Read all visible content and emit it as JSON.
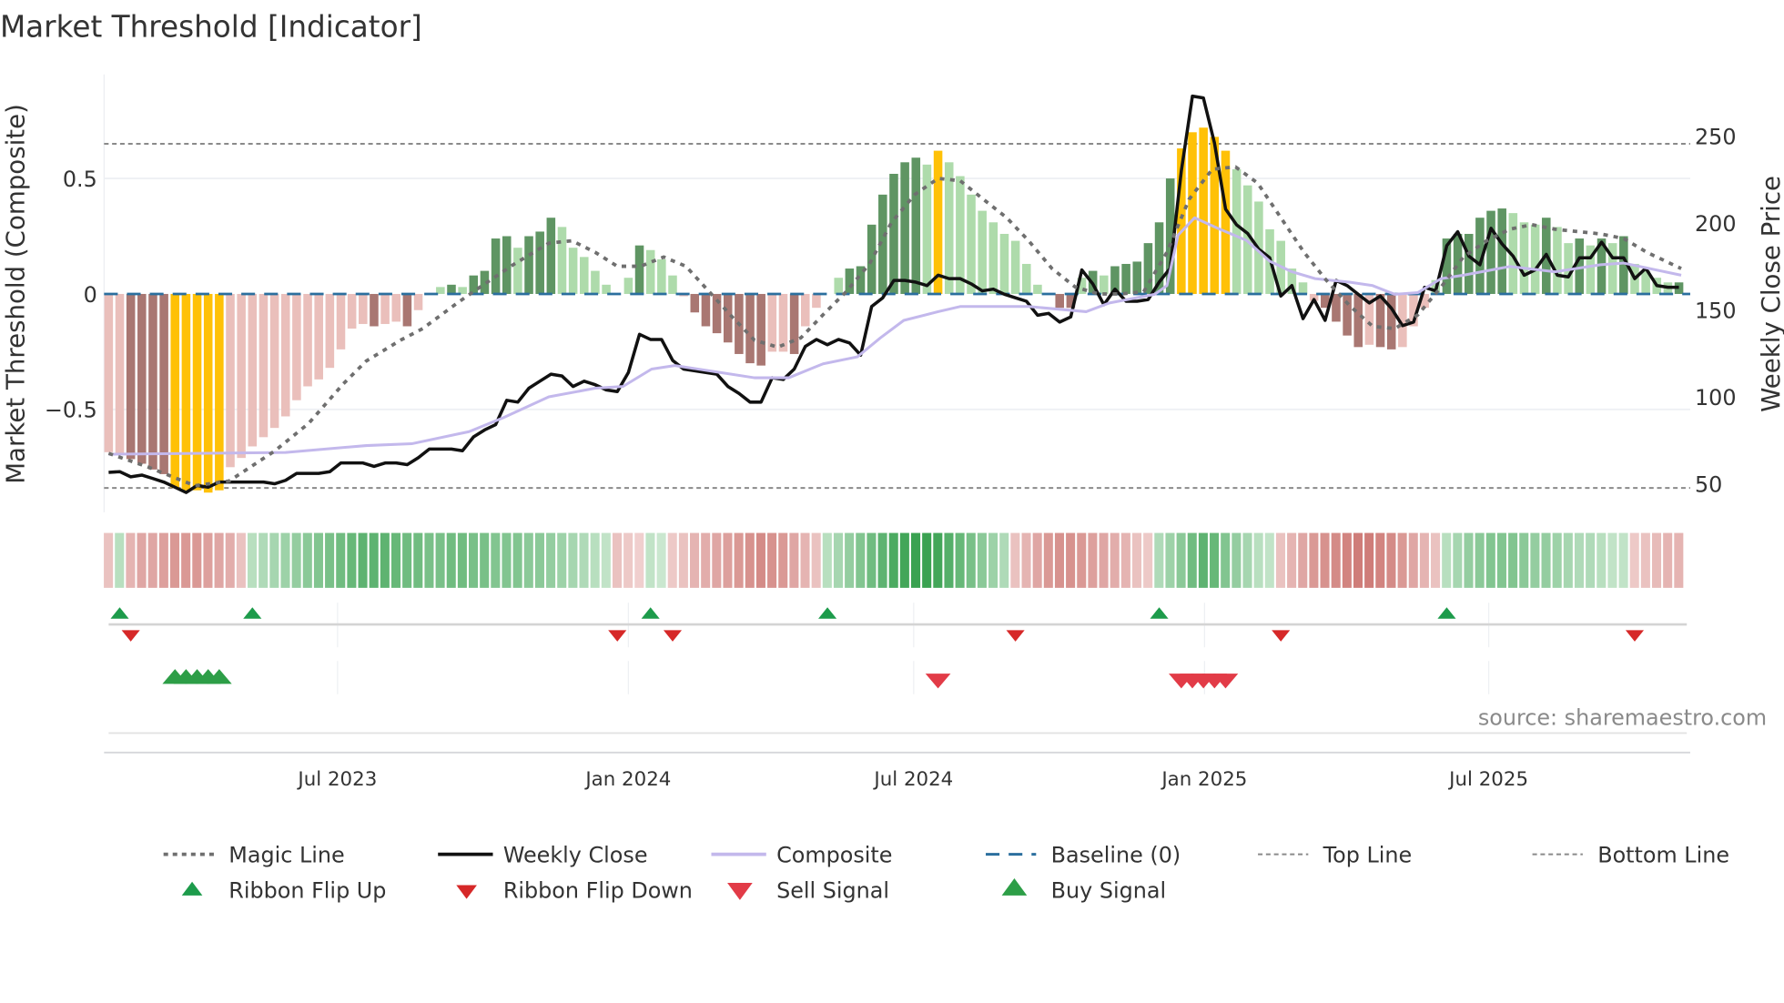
{
  "title": "Market Threshold [Indicator]",
  "source": "source: sharemaestro.com",
  "colors": {
    "bar_light_green": "#aedbab",
    "bar_dark_green": "#5f9563",
    "bar_yellow": "#ffc107",
    "bar_light_red": "#eabfbb",
    "bar_dark_red": "#a97772",
    "weekly_close": "#111111",
    "composite": "#c3b8ec",
    "magic_line": "#6f6f6f",
    "baseline": "#2b6f9e",
    "flip_up": "#1d9b4b",
    "flip_down": "#d62828",
    "buy": "#2d9e47",
    "sell": "#e23b47"
  },
  "chart_data": {
    "type": "bar",
    "title": "Market Threshold [Indicator]",
    "ylabel": "Market Threshold (Composite)",
    "ylabel_right": "Weekly Close Price",
    "ylim": [
      -0.9,
      0.9
    ],
    "ylim_right": [
      46,
      290
    ],
    "yticks": [
      {
        "v": 0.5,
        "label": "0.5"
      },
      {
        "v": 0,
        "label": "0"
      },
      {
        "v": -0.5,
        "label": "−0.5"
      }
    ],
    "yticks_right": [
      {
        "v": 250,
        "label": "250"
      },
      {
        "v": 200,
        "label": "200"
      },
      {
        "v": 150,
        "label": "150"
      },
      {
        "v": 100,
        "label": "100"
      },
      {
        "v": 50,
        "label": "50"
      }
    ],
    "xticks": [
      {
        "week": 20.7,
        "label": "Jul 2023"
      },
      {
        "week": 47.0,
        "label": "Jan 2024"
      },
      {
        "week": 72.8,
        "label": "Jul 2024"
      },
      {
        "week": 99.1,
        "label": "Jan 2025"
      },
      {
        "week": 124.8,
        "label": "Jul 2025"
      }
    ],
    "top_line": 0.65,
    "bottom_line": -0.84,
    "baseline": 0,
    "composite_bars": {
      "values": [
        -0.685,
        -0.69,
        -0.715,
        -0.735,
        -0.76,
        -0.78,
        -0.84,
        -0.85,
        -0.85,
        -0.86,
        -0.85,
        -0.75,
        -0.71,
        -0.66,
        -0.62,
        -0.58,
        -0.53,
        -0.46,
        -0.4,
        -0.37,
        -0.32,
        -0.24,
        -0.15,
        -0.13,
        -0.14,
        -0.13,
        -0.12,
        -0.14,
        -0.07,
        0,
        0.03,
        0.04,
        0.03,
        0.08,
        0.1,
        0.24,
        0.25,
        0.2,
        0.25,
        0.27,
        0.33,
        0.29,
        0.2,
        0.16,
        0.1,
        0.04,
        0,
        0.07,
        0.21,
        0.19,
        0.15,
        0.08,
        -0.01,
        -0.08,
        -0.14,
        -0.17,
        -0.21,
        -0.26,
        -0.3,
        -0.31,
        -0.25,
        -0.25,
        -0.26,
        -0.14,
        -0.06,
        0,
        0.07,
        0.11,
        0.12,
        0.3,
        0.43,
        0.52,
        0.57,
        0.59,
        0.56,
        0.62,
        0.57,
        0.51,
        0.43,
        0.36,
        0.31,
        0.26,
        0.23,
        0.13,
        0.04,
        0,
        -0.06,
        -0.06,
        0.07,
        0.1,
        0.08,
        0.12,
        0.13,
        0.14,
        0.22,
        0.31,
        0.5,
        0.63,
        0.7,
        0.72,
        0.68,
        0.62,
        0.54,
        0.47,
        0.4,
        0.28,
        0.23,
        0.11,
        0.05,
        -0.03,
        -0.06,
        -0.12,
        -0.18,
        -0.23,
        -0.22,
        -0.23,
        -0.24,
        -0.23,
        -0.14,
        -0.06,
        0.06,
        0.24,
        0.26,
        0.26,
        0.33,
        0.36,
        0.37,
        0.35,
        0.31,
        0.3,
        0.33,
        0.29,
        0.22,
        0.24,
        0.21,
        0.24,
        0.22,
        0.25,
        0.13,
        0.1,
        0.07,
        0.05,
        0.05
      ],
      "states": [
        "l",
        "l",
        "d",
        "d",
        "d",
        "d",
        "Y",
        "Y",
        "Y",
        "Y",
        "Y",
        "l",
        "l",
        "l",
        "l",
        "l",
        "l",
        "l",
        "l",
        "l",
        "l",
        "l",
        "l",
        "l",
        "d",
        "l",
        "l",
        "d",
        "l",
        "z",
        "L",
        "D",
        "L",
        "D",
        "D",
        "D",
        "D",
        "L",
        "D",
        "D",
        "D",
        "L",
        "L",
        "L",
        "L",
        "L",
        "z",
        "L",
        "D",
        "L",
        "L",
        "L",
        "l",
        "d",
        "d",
        "d",
        "d",
        "d",
        "d",
        "d",
        "l",
        "l",
        "d",
        "l",
        "l",
        "z",
        "L",
        "D",
        "D",
        "D",
        "D",
        "D",
        "D",
        "D",
        "L",
        "Y",
        "L",
        "L",
        "L",
        "L",
        "L",
        "L",
        "L",
        "L",
        "L",
        "z",
        "d",
        "d",
        "L",
        "D",
        "L",
        "D",
        "D",
        "D",
        "D",
        "D",
        "D",
        "Y",
        "Y",
        "Y",
        "Y",
        "Y",
        "L",
        "L",
        "L",
        "L",
        "L",
        "L",
        "L",
        "l",
        "d",
        "d",
        "d",
        "d",
        "l",
        "d",
        "d",
        "l",
        "l",
        "l",
        "L",
        "D",
        "D",
        "D",
        "D",
        "D",
        "D",
        "L",
        "L",
        "L",
        "D",
        "L",
        "L",
        "D",
        "L",
        "D",
        "L",
        "D",
        "L",
        "L",
        "L",
        "L",
        "D"
      ]
    },
    "series": [
      {
        "name": "Weekly Close",
        "axis": "right",
        "values": [
          56.6,
          57,
          54,
          55,
          53,
          51,
          48,
          45,
          49,
          48,
          51,
          51,
          51,
          51,
          51,
          50,
          52,
          56,
          56,
          56,
          57,
          62,
          62,
          62,
          60,
          62,
          62,
          61,
          65,
          70,
          70,
          70,
          69,
          77,
          81,
          84,
          98,
          97,
          105,
          109,
          113,
          112,
          106,
          109,
          107,
          104,
          103,
          114,
          136,
          133,
          133,
          121,
          116,
          115,
          114,
          113,
          106,
          102,
          97,
          97,
          111,
          110,
          116,
          129,
          133,
          130,
          133,
          131,
          124,
          152,
          157,
          167,
          167,
          166,
          164,
          170,
          168,
          168,
          165,
          161,
          162,
          159,
          157,
          155,
          147,
          148,
          143,
          146,
          173,
          165,
          153,
          162,
          155,
          155,
          156,
          166,
          174,
          230,
          273,
          272,
          246,
          208,
          199,
          194,
          185,
          180,
          158,
          164,
          145,
          156,
          144,
          167,
          164,
          159,
          154,
          158,
          151,
          141,
          143,
          163,
          161,
          187,
          195,
          181,
          176,
          197,
          188,
          181,
          170,
          173,
          182,
          170,
          169,
          180,
          180,
          189,
          180,
          180,
          168,
          174,
          164,
          163,
          163
        ]
      },
      {
        "name": "Composite",
        "axis": "right",
        "points": [
          [
            0,
            67
          ],
          [
            16,
            68
          ],
          [
            23.3,
            72
          ],
          [
            27.4,
            73
          ],
          [
            32.6,
            80
          ],
          [
            35.7,
            88
          ],
          [
            39.8,
            100
          ],
          [
            44,
            105
          ],
          [
            46.5,
            106
          ],
          [
            49.1,
            116
          ],
          [
            51.2,
            118
          ],
          [
            55.3,
            114
          ],
          [
            58.4,
            111
          ],
          [
            61.5,
            111
          ],
          [
            64.6,
            119
          ],
          [
            67.7,
            123
          ],
          [
            69.8,
            134
          ],
          [
            71.9,
            144
          ],
          [
            75,
            149
          ],
          [
            77,
            152
          ],
          [
            83.2,
            152
          ],
          [
            88.4,
            149
          ],
          [
            90.5,
            154
          ],
          [
            94.6,
            159
          ],
          [
            95.7,
            164
          ],
          [
            96.7,
            193
          ],
          [
            98.2,
            203
          ],
          [
            100.3,
            197
          ],
          [
            102.9,
            190
          ],
          [
            105,
            178
          ],
          [
            107,
            172
          ],
          [
            109.1,
            168
          ],
          [
            112.2,
            166
          ],
          [
            114.3,
            164
          ],
          [
            116.3,
            159
          ],
          [
            118.4,
            160
          ],
          [
            120.5,
            168
          ],
          [
            122.5,
            170
          ],
          [
            126.7,
            175
          ],
          [
            130.8,
            172
          ],
          [
            134.9,
            176
          ],
          [
            137,
            177
          ],
          [
            142.2,
            170
          ]
        ]
      },
      {
        "name": "Magic Line",
        "axis": "left",
        "points": [
          [
            0,
            -0.69
          ],
          [
            3.6,
            -0.75
          ],
          [
            7.8,
            -0.83
          ],
          [
            10.9,
            -0.81
          ],
          [
            15,
            -0.68
          ],
          [
            18.1,
            -0.56
          ],
          [
            21.2,
            -0.39
          ],
          [
            23.3,
            -0.29
          ],
          [
            26.4,
            -0.2
          ],
          [
            28.4,
            -0.15
          ],
          [
            31.5,
            -0.04
          ],
          [
            33.6,
            0.03
          ],
          [
            36.7,
            0.13
          ],
          [
            39.8,
            0.22
          ],
          [
            41.9,
            0.23
          ],
          [
            44,
            0.18
          ],
          [
            46,
            0.12
          ],
          [
            48.1,
            0.12
          ],
          [
            50.2,
            0.16
          ],
          [
            52.2,
            0.12
          ],
          [
            54.3,
            0.01
          ],
          [
            56.4,
            -0.1
          ],
          [
            58.4,
            -0.2
          ],
          [
            60.5,
            -0.23
          ],
          [
            62.6,
            -0.19
          ],
          [
            64.6,
            -0.09
          ],
          [
            66.7,
            0.01
          ],
          [
            68.8,
            0.13
          ],
          [
            70.8,
            0.31
          ],
          [
            72.9,
            0.43
          ],
          [
            75,
            0.5
          ],
          [
            77,
            0.49
          ],
          [
            79.1,
            0.41
          ],
          [
            81.2,
            0.33
          ],
          [
            83.2,
            0.23
          ],
          [
            85.3,
            0.11
          ],
          [
            87.4,
            0.03
          ],
          [
            89.5,
            0
          ],
          [
            91.5,
            0
          ],
          [
            93.6,
            0.01
          ],
          [
            95.7,
            0.18
          ],
          [
            97.7,
            0.41
          ],
          [
            99.8,
            0.54
          ],
          [
            101.9,
            0.55
          ],
          [
            103.9,
            0.48
          ],
          [
            106,
            0.33
          ],
          [
            108.1,
            0.18
          ],
          [
            110.1,
            0.06
          ],
          [
            112.2,
            -0.05
          ],
          [
            114.3,
            -0.14
          ],
          [
            116.3,
            -0.15
          ],
          [
            118.4,
            -0.09
          ],
          [
            120.5,
            0.03
          ],
          [
            122.5,
            0.16
          ],
          [
            124.6,
            0.23
          ],
          [
            126.7,
            0.28
          ],
          [
            128.7,
            0.3
          ],
          [
            130.8,
            0.28
          ],
          [
            134.9,
            0.26
          ],
          [
            137,
            0.24
          ],
          [
            139.1,
            0.18
          ],
          [
            142.2,
            0.11
          ]
        ]
      }
    ],
    "ribbon": [
      -0.2,
      0.2,
      -0.3,
      -0.4,
      -0.4,
      -0.45,
      -0.5,
      -0.5,
      -0.5,
      -0.45,
      -0.4,
      -0.35,
      -0.2,
      0.2,
      0.25,
      0.3,
      0.35,
      0.4,
      0.45,
      0.5,
      0.55,
      0.6,
      0.65,
      0.7,
      0.7,
      0.7,
      0.65,
      0.6,
      0.6,
      0.55,
      0.55,
      0.6,
      0.6,
      0.55,
      0.55,
      0.5,
      0.5,
      0.5,
      0.45,
      0.45,
      0.4,
      0.35,
      0.3,
      0.25,
      0.2,
      0.15,
      -0.2,
      -0.15,
      -0.1,
      0.15,
      0.1,
      -0.15,
      -0.2,
      -0.3,
      -0.35,
      -0.4,
      -0.45,
      -0.5,
      -0.55,
      -0.6,
      -0.55,
      -0.5,
      -0.4,
      -0.3,
      -0.2,
      0.2,
      0.3,
      0.4,
      0.5,
      0.6,
      0.7,
      0.8,
      0.85,
      0.9,
      0.9,
      0.85,
      0.75,
      0.65,
      0.55,
      0.45,
      0.35,
      0.25,
      -0.2,
      -0.3,
      -0.4,
      -0.5,
      -0.55,
      -0.55,
      -0.5,
      -0.45,
      -0.4,
      -0.35,
      -0.3,
      -0.2,
      -0.15,
      0.25,
      0.35,
      0.45,
      0.6,
      0.7,
      0.65,
      0.5,
      0.4,
      0.3,
      0.2,
      0.15,
      -0.2,
      -0.3,
      -0.4,
      -0.5,
      -0.55,
      -0.6,
      -0.65,
      -0.7,
      -0.7,
      -0.65,
      -0.6,
      -0.5,
      -0.4,
      -0.3,
      -0.2,
      0.2,
      0.3,
      0.4,
      0.45,
      0.5,
      0.5,
      0.5,
      0.45,
      0.4,
      0.4,
      0.35,
      0.3,
      0.25,
      0.25,
      0.2,
      0.15,
      0.15,
      -0.15,
      -0.2,
      -0.25,
      -0.3,
      -0.3
    ],
    "ribbon_flip_up_weeks": [
      1,
      13,
      49,
      65,
      95,
      121
    ],
    "ribbon_flip_down_weeks": [
      2,
      46,
      51,
      82,
      106,
      138
    ],
    "buy_signal_weeks": [
      6,
      7,
      8,
      9,
      10
    ],
    "sell_signal_weeks": [
      75,
      97,
      98,
      99,
      100,
      101
    ],
    "legend": [
      {
        "key": "magic",
        "label": "Magic Line"
      },
      {
        "key": "close",
        "label": "Weekly Close"
      },
      {
        "key": "composite",
        "label": "Composite"
      },
      {
        "key": "baseline",
        "label": "Baseline (0)"
      },
      {
        "key": "top",
        "label": "Top Line"
      },
      {
        "key": "bottom",
        "label": "Bottom Line"
      },
      {
        "key": "flipup",
        "label": "Ribbon Flip Up"
      },
      {
        "key": "flipdown",
        "label": "Ribbon Flip Down"
      },
      {
        "key": "sell",
        "label": "Sell Signal"
      },
      {
        "key": "buy",
        "label": "Buy Signal"
      }
    ]
  }
}
